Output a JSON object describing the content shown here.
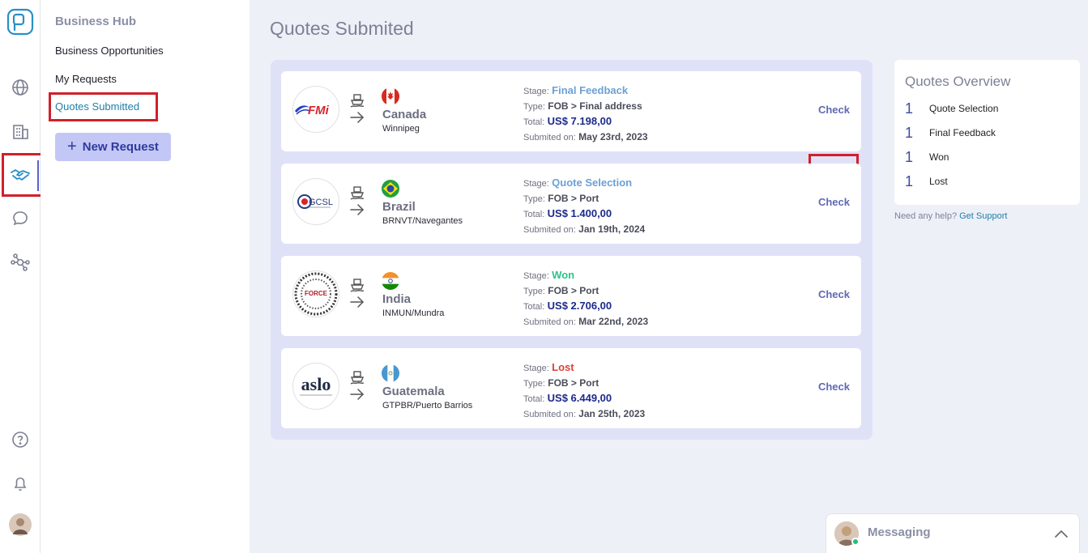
{
  "nav": {
    "hub_title": "Business Hub",
    "items": [
      {
        "label": "Business Opportunities"
      },
      {
        "label": "My Requests"
      },
      {
        "label": "Quotes Submitted"
      }
    ],
    "new_request": "New Request"
  },
  "page": {
    "title": "Quotes Submited"
  },
  "labels": {
    "stage": "Stage:",
    "type": "Type:",
    "total": "Total:",
    "submitted": "Submited on:"
  },
  "quotes": [
    {
      "logo_text": "FMi",
      "country": "Canada",
      "port": "Winnipeg",
      "stage": "Final Feedback",
      "type": "FOB > Final address",
      "total": "US$ 7.198,00",
      "submitted": "May 23rd, 2023",
      "action": "Check"
    },
    {
      "logo_text": "GCSL",
      "country": "Brazil",
      "port": "BRNVT/Navegantes",
      "stage": "Quote Selection",
      "type": "FOB > Port",
      "total": "US$ 1.400,00",
      "submitted": "Jan 19th, 2024",
      "action": "Check"
    },
    {
      "logo_text": "FORCE",
      "country": "India",
      "port": "INMUN/Mundra",
      "stage": "Won",
      "type": "FOB > Port",
      "total": "US$ 2.706,00",
      "submitted": "Mar 22nd, 2023",
      "action": "Check"
    },
    {
      "logo_text": "aslo",
      "country": "Guatemala",
      "port": "GTPBR/Puerto Barrios",
      "stage": "Lost",
      "type": "FOB > Port",
      "total": "US$ 6.449,00",
      "submitted": "Jan 25th, 2023",
      "action": "Check"
    }
  ],
  "overview": {
    "title": "Quotes Overview",
    "rows": [
      {
        "count": "1",
        "label": "Quote Selection"
      },
      {
        "count": "1",
        "label": "Final Feedback"
      },
      {
        "count": "1",
        "label": "Won"
      },
      {
        "count": "1",
        "label": "Lost"
      }
    ]
  },
  "help": {
    "text": "Need any help?",
    "link": "Get Support"
  },
  "messaging": {
    "label": "Messaging"
  },
  "colors": {
    "accent": "#5a62c8",
    "highlight": "#d0202a",
    "won": "#2bc48a",
    "lost": "#d8433a",
    "stage": "#6ca0d4"
  }
}
